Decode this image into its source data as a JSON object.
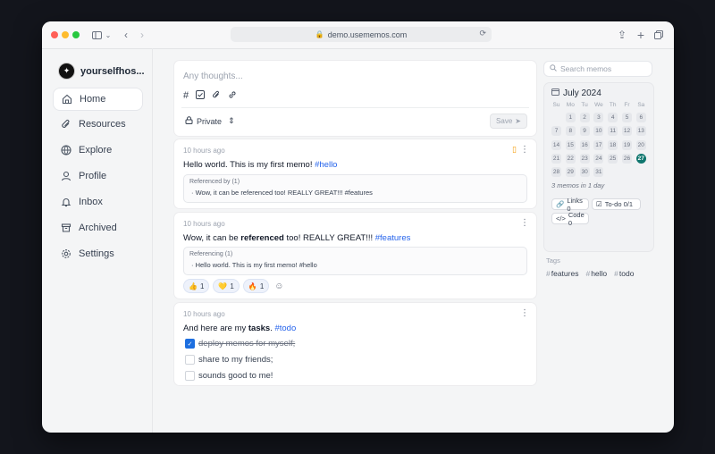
{
  "browser": {
    "url": "demo.usememos.com",
    "lock_icon": "lock-icon"
  },
  "sidebar": {
    "username": "yourselfhos...",
    "items": [
      {
        "label": "Home",
        "icon": "home-icon"
      },
      {
        "label": "Resources",
        "icon": "paperclip-icon"
      },
      {
        "label": "Explore",
        "icon": "globe-icon"
      },
      {
        "label": "Profile",
        "icon": "user-icon"
      },
      {
        "label": "Inbox",
        "icon": "bell-icon"
      },
      {
        "label": "Archived",
        "icon": "archive-icon"
      },
      {
        "label": "Settings",
        "icon": "gear-icon"
      }
    ]
  },
  "editor": {
    "placeholder": "Any thoughts...",
    "visibility": "Private",
    "save_label": "Save"
  },
  "memos": [
    {
      "time": "10 hours ago",
      "text": "Hello world. This is my first memo! ",
      "tag": "#hello",
      "ref_header": "Referenced by (1)",
      "ref_text": "Wow, it can be referenced too! REALLY GREAT!!! #features"
    },
    {
      "time": "10 hours ago",
      "text_before": "Wow, it can be ",
      "bold": "referenced",
      "text_after": " too! REALLY GREAT!!! ",
      "tag": "#features",
      "ref_header": "Referencing (1)",
      "ref_text": "Hello world. This is my first memo! #hello",
      "reactions": [
        {
          "emoji": "👍",
          "count": "1"
        },
        {
          "emoji": "💛",
          "count": "1"
        },
        {
          "emoji": "🔥",
          "count": "1"
        }
      ]
    },
    {
      "time": "10 hours ago",
      "text_before": "And here are my ",
      "bold": "tasks",
      "text_after": ". ",
      "tag": "#todo",
      "todos": [
        {
          "text": "deploy memos for myself;",
          "done": true
        },
        {
          "text": "share to my friends;",
          "done": false
        },
        {
          "text": "sounds good to me!",
          "done": false
        }
      ]
    }
  ],
  "right": {
    "search_placeholder": "Search memos",
    "calendar": {
      "month": "July 2024",
      "weekdays": [
        "Su",
        "Mo",
        "Tu",
        "We",
        "Th",
        "Fr",
        "Sa"
      ],
      "today": "27",
      "summary": "3 memos in 1 day"
    },
    "stats": {
      "links": "Links 0",
      "todo": "To-do 0/1",
      "code": "Code 0"
    },
    "tags_title": "Tags",
    "tags": [
      "features",
      "hello",
      "todo"
    ]
  }
}
